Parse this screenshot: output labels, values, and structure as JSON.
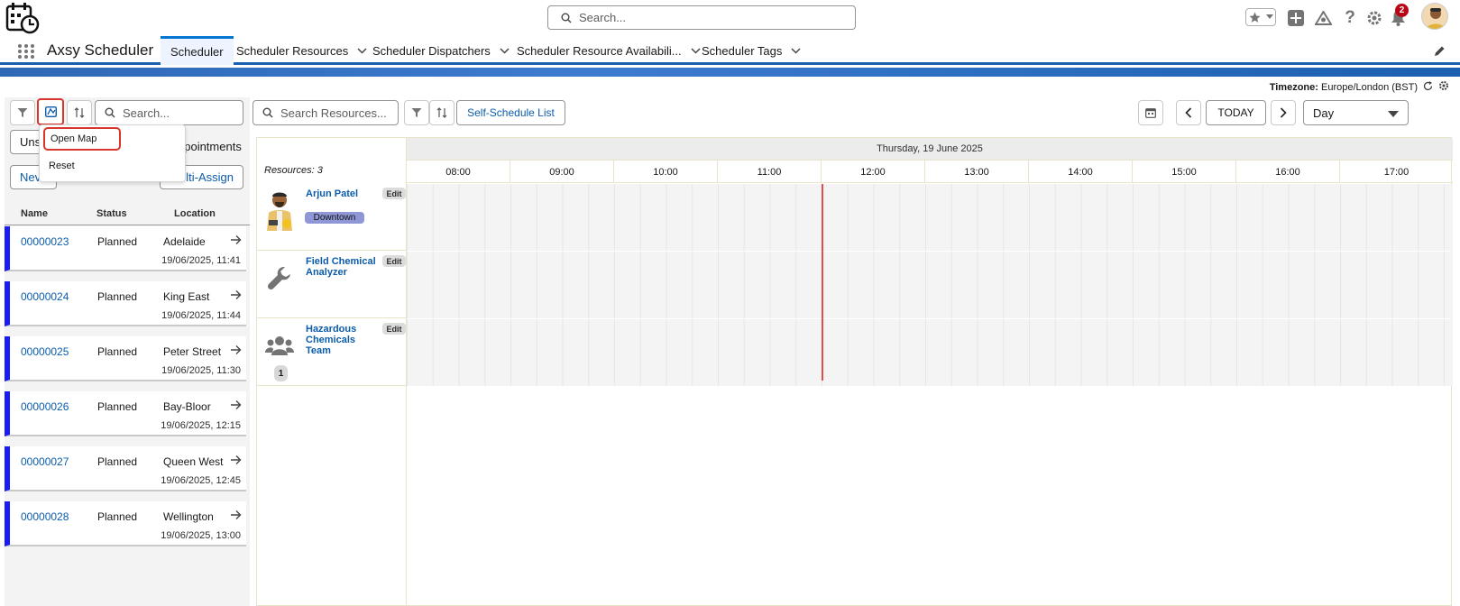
{
  "header": {
    "search_placeholder": "Search...",
    "notification_count": "2"
  },
  "nav": {
    "app_name": "Axsy Scheduler",
    "tabs": [
      {
        "label": "Scheduler"
      },
      {
        "label": "Scheduler Resources"
      },
      {
        "label": "Scheduler Dispatchers"
      },
      {
        "label": "Scheduler Resource Availabili..."
      },
      {
        "label": "Scheduler Tags"
      }
    ]
  },
  "timezone": {
    "label": "Timezone:",
    "value": "Europe/London (BST)"
  },
  "left": {
    "search_placeholder": "Search...",
    "unscheduled_label": "Uns",
    "appointments_label": "ppointments",
    "new_label": "Nev",
    "multi_assign_label": "lti-Assign",
    "menu": {
      "open_map": "Open Map",
      "reset": "Reset"
    },
    "columns": {
      "name": "Name",
      "status": "Status",
      "location": "Location"
    },
    "appointments": [
      {
        "id": "00000023",
        "status": "Planned",
        "location": "Adelaide",
        "datetime": "19/06/2025, 11:41"
      },
      {
        "id": "00000024",
        "status": "Planned",
        "location": "King East",
        "datetime": "19/06/2025, 11:44"
      },
      {
        "id": "00000025",
        "status": "Planned",
        "location": "Peter Street",
        "datetime": "19/06/2025, 11:30"
      },
      {
        "id": "00000026",
        "status": "Planned",
        "location": "Bay-Bloor",
        "datetime": "19/06/2025, 12:15"
      },
      {
        "id": "00000027",
        "status": "Planned",
        "location": "Queen West",
        "datetime": "19/06/2025, 12:45"
      },
      {
        "id": "00000028",
        "status": "Planned",
        "location": "Wellington",
        "datetime": "19/06/2025, 13:00"
      }
    ]
  },
  "right": {
    "search_placeholder": "Search Resources...",
    "self_schedule_label": "Self-Schedule List",
    "today_label": "TODAY",
    "view_value": "Day",
    "date_label": "Thursday, 19 June 2025",
    "resources_count": "Resources: 3",
    "hours": [
      "08:00",
      "09:00",
      "10:00",
      "11:00",
      "12:00",
      "13:00",
      "14:00",
      "15:00",
      "16:00",
      "17:00"
    ],
    "resources": [
      {
        "name": "Arjun Patel",
        "edit": "Edit",
        "tag": "Downtown",
        "icon": "person-avatar"
      },
      {
        "name": "Field Chemical Analyzer",
        "edit": "Edit",
        "icon": "wrench-icon"
      },
      {
        "name": "Hazardous Chemicals Team",
        "edit": "Edit",
        "badge": "1",
        "icon": "team-icon"
      }
    ]
  },
  "colors": {
    "accent": "#0176d3",
    "link": "#0b5cab",
    "appointment_bar": "#1b1bf5",
    "now_line": "#ea4a4a",
    "highlight": "#d9362b"
  }
}
